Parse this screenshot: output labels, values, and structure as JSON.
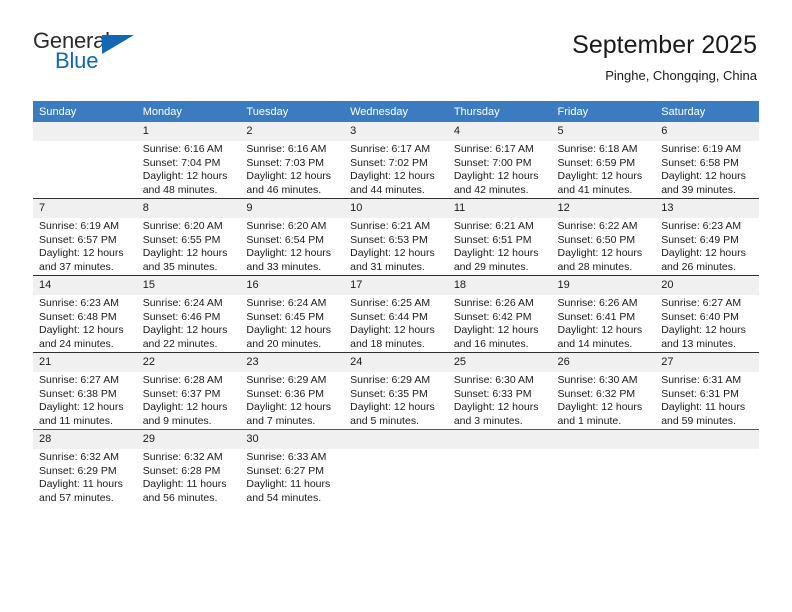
{
  "brand": {
    "name_part1": "General",
    "name_part2": "Blue",
    "triangle_color": "#1268b3"
  },
  "header": {
    "title": "September 2025",
    "subtitle": "Pinghe, Chongqing, China"
  },
  "theme": {
    "header_row_bg": "#3b7cc0",
    "header_row_text": "#ffffff",
    "daynum_bg": "#f0f0f0",
    "row_separator": "#2f2f2f",
    "last_row_separator": "#1268b3"
  },
  "weekdays": [
    "Sunday",
    "Monday",
    "Tuesday",
    "Wednesday",
    "Thursday",
    "Friday",
    "Saturday"
  ],
  "weeks": [
    [
      {
        "day": "",
        "sunrise": "",
        "sunset": "",
        "daylight1": "",
        "daylight2": "",
        "blank": true
      },
      {
        "day": "1",
        "sunrise": "Sunrise: 6:16 AM",
        "sunset": "Sunset: 7:04 PM",
        "daylight1": "Daylight: 12 hours",
        "daylight2": "and 48 minutes."
      },
      {
        "day": "2",
        "sunrise": "Sunrise: 6:16 AM",
        "sunset": "Sunset: 7:03 PM",
        "daylight1": "Daylight: 12 hours",
        "daylight2": "and 46 minutes."
      },
      {
        "day": "3",
        "sunrise": "Sunrise: 6:17 AM",
        "sunset": "Sunset: 7:02 PM",
        "daylight1": "Daylight: 12 hours",
        "daylight2": "and 44 minutes."
      },
      {
        "day": "4",
        "sunrise": "Sunrise: 6:17 AM",
        "sunset": "Sunset: 7:00 PM",
        "daylight1": "Daylight: 12 hours",
        "daylight2": "and 42 minutes."
      },
      {
        "day": "5",
        "sunrise": "Sunrise: 6:18 AM",
        "sunset": "Sunset: 6:59 PM",
        "daylight1": "Daylight: 12 hours",
        "daylight2": "and 41 minutes."
      },
      {
        "day": "6",
        "sunrise": "Sunrise: 6:19 AM",
        "sunset": "Sunset: 6:58 PM",
        "daylight1": "Daylight: 12 hours",
        "daylight2": "and 39 minutes."
      }
    ],
    [
      {
        "day": "7",
        "sunrise": "Sunrise: 6:19 AM",
        "sunset": "Sunset: 6:57 PM",
        "daylight1": "Daylight: 12 hours",
        "daylight2": "and 37 minutes."
      },
      {
        "day": "8",
        "sunrise": "Sunrise: 6:20 AM",
        "sunset": "Sunset: 6:55 PM",
        "daylight1": "Daylight: 12 hours",
        "daylight2": "and 35 minutes."
      },
      {
        "day": "9",
        "sunrise": "Sunrise: 6:20 AM",
        "sunset": "Sunset: 6:54 PM",
        "daylight1": "Daylight: 12 hours",
        "daylight2": "and 33 minutes."
      },
      {
        "day": "10",
        "sunrise": "Sunrise: 6:21 AM",
        "sunset": "Sunset: 6:53 PM",
        "daylight1": "Daylight: 12 hours",
        "daylight2": "and 31 minutes."
      },
      {
        "day": "11",
        "sunrise": "Sunrise: 6:21 AM",
        "sunset": "Sunset: 6:51 PM",
        "daylight1": "Daylight: 12 hours",
        "daylight2": "and 29 minutes."
      },
      {
        "day": "12",
        "sunrise": "Sunrise: 6:22 AM",
        "sunset": "Sunset: 6:50 PM",
        "daylight1": "Daylight: 12 hours",
        "daylight2": "and 28 minutes."
      },
      {
        "day": "13",
        "sunrise": "Sunrise: 6:23 AM",
        "sunset": "Sunset: 6:49 PM",
        "daylight1": "Daylight: 12 hours",
        "daylight2": "and 26 minutes."
      }
    ],
    [
      {
        "day": "14",
        "sunrise": "Sunrise: 6:23 AM",
        "sunset": "Sunset: 6:48 PM",
        "daylight1": "Daylight: 12 hours",
        "daylight2": "and 24 minutes."
      },
      {
        "day": "15",
        "sunrise": "Sunrise: 6:24 AM",
        "sunset": "Sunset: 6:46 PM",
        "daylight1": "Daylight: 12 hours",
        "daylight2": "and 22 minutes."
      },
      {
        "day": "16",
        "sunrise": "Sunrise: 6:24 AM",
        "sunset": "Sunset: 6:45 PM",
        "daylight1": "Daylight: 12 hours",
        "daylight2": "and 20 minutes."
      },
      {
        "day": "17",
        "sunrise": "Sunrise: 6:25 AM",
        "sunset": "Sunset: 6:44 PM",
        "daylight1": "Daylight: 12 hours",
        "daylight2": "and 18 minutes."
      },
      {
        "day": "18",
        "sunrise": "Sunrise: 6:26 AM",
        "sunset": "Sunset: 6:42 PM",
        "daylight1": "Daylight: 12 hours",
        "daylight2": "and 16 minutes."
      },
      {
        "day": "19",
        "sunrise": "Sunrise: 6:26 AM",
        "sunset": "Sunset: 6:41 PM",
        "daylight1": "Daylight: 12 hours",
        "daylight2": "and 14 minutes."
      },
      {
        "day": "20",
        "sunrise": "Sunrise: 6:27 AM",
        "sunset": "Sunset: 6:40 PM",
        "daylight1": "Daylight: 12 hours",
        "daylight2": "and 13 minutes."
      }
    ],
    [
      {
        "day": "21",
        "sunrise": "Sunrise: 6:27 AM",
        "sunset": "Sunset: 6:38 PM",
        "daylight1": "Daylight: 12 hours",
        "daylight2": "and 11 minutes."
      },
      {
        "day": "22",
        "sunrise": "Sunrise: 6:28 AM",
        "sunset": "Sunset: 6:37 PM",
        "daylight1": "Daylight: 12 hours",
        "daylight2": "and 9 minutes."
      },
      {
        "day": "23",
        "sunrise": "Sunrise: 6:29 AM",
        "sunset": "Sunset: 6:36 PM",
        "daylight1": "Daylight: 12 hours",
        "daylight2": "and 7 minutes."
      },
      {
        "day": "24",
        "sunrise": "Sunrise: 6:29 AM",
        "sunset": "Sunset: 6:35 PM",
        "daylight1": "Daylight: 12 hours",
        "daylight2": "and 5 minutes."
      },
      {
        "day": "25",
        "sunrise": "Sunrise: 6:30 AM",
        "sunset": "Sunset: 6:33 PM",
        "daylight1": "Daylight: 12 hours",
        "daylight2": "and 3 minutes."
      },
      {
        "day": "26",
        "sunrise": "Sunrise: 6:30 AM",
        "sunset": "Sunset: 6:32 PM",
        "daylight1": "Daylight: 12 hours",
        "daylight2": "and 1 minute."
      },
      {
        "day": "27",
        "sunrise": "Sunrise: 6:31 AM",
        "sunset": "Sunset: 6:31 PM",
        "daylight1": "Daylight: 11 hours",
        "daylight2": "and 59 minutes."
      }
    ],
    [
      {
        "day": "28",
        "sunrise": "Sunrise: 6:32 AM",
        "sunset": "Sunset: 6:29 PM",
        "daylight1": "Daylight: 11 hours",
        "daylight2": "and 57 minutes."
      },
      {
        "day": "29",
        "sunrise": "Sunrise: 6:32 AM",
        "sunset": "Sunset: 6:28 PM",
        "daylight1": "Daylight: 11 hours",
        "daylight2": "and 56 minutes."
      },
      {
        "day": "30",
        "sunrise": "Sunrise: 6:33 AM",
        "sunset": "Sunset: 6:27 PM",
        "daylight1": "Daylight: 11 hours",
        "daylight2": "and 54 minutes."
      },
      {
        "day": "",
        "sunrise": "",
        "sunset": "",
        "daylight1": "",
        "daylight2": "",
        "blank": true
      },
      {
        "day": "",
        "sunrise": "",
        "sunset": "",
        "daylight1": "",
        "daylight2": "",
        "blank": true
      },
      {
        "day": "",
        "sunrise": "",
        "sunset": "",
        "daylight1": "",
        "daylight2": "",
        "blank": true
      },
      {
        "day": "",
        "sunrise": "",
        "sunset": "",
        "daylight1": "",
        "daylight2": "",
        "blank": true
      }
    ]
  ]
}
